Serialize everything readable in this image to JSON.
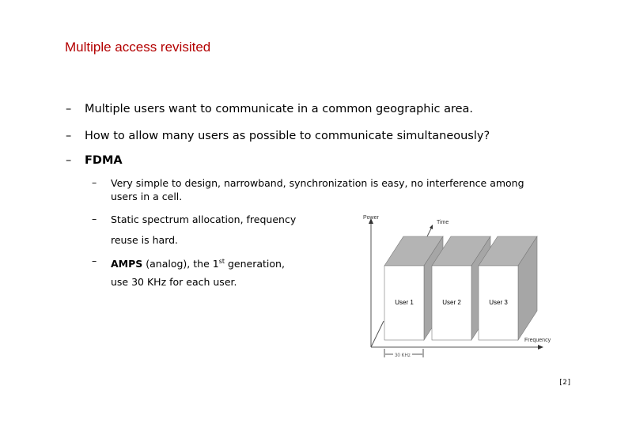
{
  "slide": {
    "title": "Multiple access revisited",
    "bullets": [
      {
        "dash": "–",
        "text": "Multiple users want to communicate in a common geographic area."
      },
      {
        "dash": "–",
        "text": "How to allow many users as possible to communicate simultaneously?"
      },
      {
        "dash": "–",
        "text": "FDMA"
      }
    ],
    "sub_bullets": [
      {
        "dash": "–",
        "line1": "Very simple to design, narrowband, synchronization is easy, no interference among",
        "line2": "users in a cell."
      },
      {
        "dash": "–",
        "line1": "Static spectrum allocation, frequency",
        "line2": "reuse is hard."
      },
      {
        "dash": "–",
        "bold": "AMPS",
        "line1_rest": " (analog), the 1",
        "sup": "st",
        "line1_end": " generation,",
        "line2": "use 30 KHz for each user."
      }
    ],
    "page_number": "[2]"
  },
  "diagram": {
    "axis_power": "Power",
    "axis_time": "Time",
    "axis_frequency": "Frequency",
    "bandwidth_label": "30 KHz",
    "users": [
      "User 1",
      "User 2",
      "User 3"
    ]
  }
}
